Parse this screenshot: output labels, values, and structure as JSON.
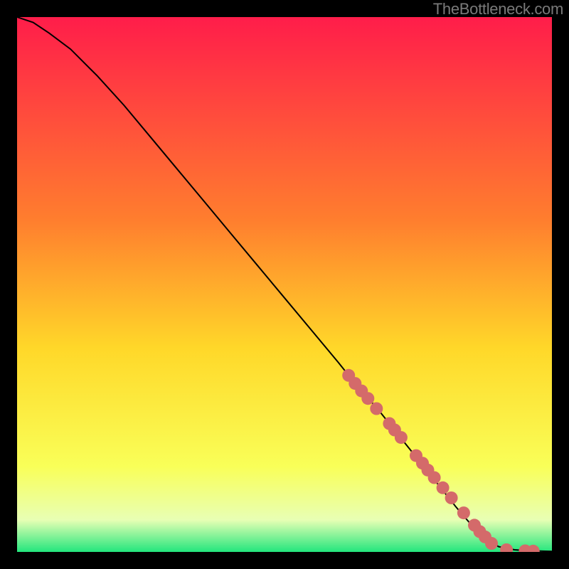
{
  "attribution": "TheBottleneck.com",
  "colors": {
    "gradient_top": "#ff1d4a",
    "gradient_mid1": "#ff7e2e",
    "gradient_mid2": "#ffd829",
    "gradient_mid3": "#f9ff58",
    "gradient_mid4": "#e8ffb4",
    "gradient_bottom": "#23e67d",
    "curve": "#000000",
    "marker": "#d46a6a",
    "frame_bg": "#000000"
  },
  "chart_data": {
    "type": "line",
    "title": "",
    "xlabel": "",
    "ylabel": "",
    "xlim": [
      0,
      100
    ],
    "ylim": [
      0,
      100
    ],
    "series": [
      {
        "name": "curve",
        "x": [
          0,
          3,
          6,
          10,
          15,
          20,
          25,
          30,
          35,
          40,
          45,
          50,
          55,
          60,
          62,
          65,
          68,
          70,
          72,
          74,
          76,
          78,
          80,
          82,
          83,
          85,
          87,
          90,
          93,
          96,
          100
        ],
        "y": [
          100,
          99,
          97,
          94,
          89,
          83.5,
          77.5,
          71.5,
          65.5,
          59.5,
          53.5,
          47.5,
          41.5,
          35.5,
          33,
          29.5,
          26,
          23.5,
          21,
          18.5,
          16,
          13.5,
          11,
          8.5,
          7.3,
          5,
          3,
          1,
          0.4,
          0.2,
          0.1
        ]
      }
    ],
    "markers": {
      "name": "highlighted-points",
      "x": [
        62,
        63.2,
        64.4,
        65.6,
        67.2,
        69.6,
        70.6,
        71.8,
        74.6,
        75.8,
        76.8,
        78.0,
        79.6,
        81.2,
        83.5,
        85.5,
        86.5,
        87.5,
        88.7,
        91.5,
        95.0,
        96.5
      ],
      "y": [
        33.0,
        31.5,
        30.1,
        28.7,
        26.8,
        24.0,
        22.8,
        21.4,
        18.0,
        16.6,
        15.3,
        13.9,
        12.0,
        10.1,
        7.3,
        5.0,
        3.8,
        2.8,
        1.6,
        0.4,
        0.2,
        0.15
      ]
    }
  }
}
